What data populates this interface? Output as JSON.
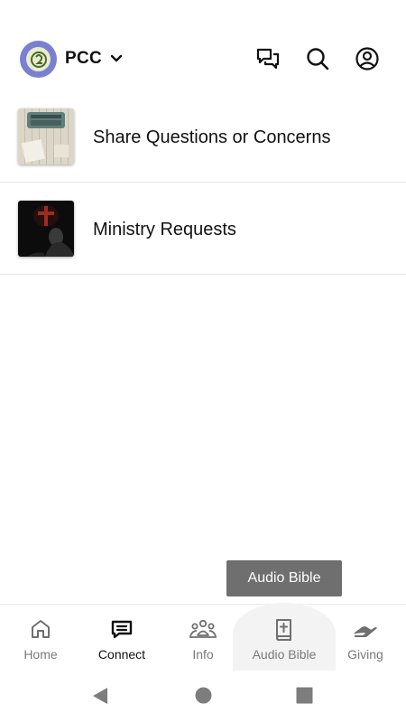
{
  "header": {
    "org_name": "PCC",
    "icons": [
      "chat-icon",
      "search-icon",
      "account-icon"
    ]
  },
  "list": {
    "items": [
      {
        "label": "Share Questions or Concerns",
        "thumb": "typewriter-photo"
      },
      {
        "label": "Ministry Requests",
        "thumb": "cross-prayer-photo"
      }
    ]
  },
  "tooltip": {
    "text": "Audio Bible"
  },
  "tabs": [
    {
      "label": "Home",
      "icon": "home-icon",
      "active": false
    },
    {
      "label": "Connect",
      "icon": "connect-icon",
      "active": true
    },
    {
      "label": "Info",
      "icon": "people-icon",
      "active": false
    },
    {
      "label": "Audio Bible",
      "icon": "bible-icon",
      "active": false
    },
    {
      "label": "Giving",
      "icon": "giving-hand-icon",
      "active": false
    }
  ],
  "colors": {
    "logo_ring": "#7b7fd1",
    "tooltip_bg": "#6f6f6f",
    "active_label": "#111111",
    "inactive_label": "#7a7a7a"
  }
}
